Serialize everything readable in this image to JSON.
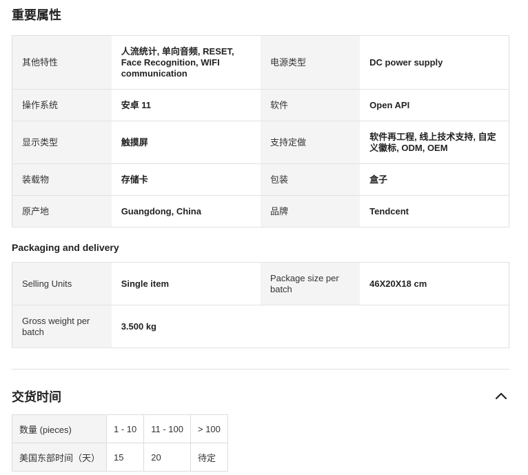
{
  "sections": {
    "key_attributes_title": "重要属性",
    "packaging_title": "Packaging and delivery",
    "lead_time_title": "交货时间"
  },
  "attributes": [
    {
      "k1": "其他特性",
      "v1": "人流统计, 单向音频, RESET, Face Recognition, WIFI communication",
      "k2": "电源类型",
      "v2": "DC power supply"
    },
    {
      "k1": "操作系统",
      "v1": "安卓 11",
      "k2": "软件",
      "v2": "Open API"
    },
    {
      "k1": "显示类型",
      "v1": "触摸屏",
      "k2": "支持定做",
      "v2": "软件再工程, 线上技术支持, 自定义徽标, ODM, OEM"
    },
    {
      "k1": "装载物",
      "v1": "存储卡",
      "k2": "包装",
      "v2": "盒子"
    },
    {
      "k1": "原产地",
      "v1": "Guangdong, China",
      "k2": "品牌",
      "v2": "Tendcent"
    }
  ],
  "packaging": [
    {
      "k1": "Selling Units",
      "v1": "Single item",
      "k2": "Package size per batch",
      "v2": "46X20X18 cm"
    },
    {
      "k1": "Gross weight per batch",
      "v1": "3.500 kg",
      "k2": "",
      "v2": ""
    }
  ],
  "lead_time": {
    "header": [
      "数量 (pieces)",
      "1 - 10",
      "11 - 100",
      "> 100"
    ],
    "row": [
      "美国东部时间（天）",
      "15",
      "20",
      "待定"
    ]
  },
  "icons": {
    "collapse": "chevron-up-icon"
  },
  "colors": {
    "label_bg": "#f4f4f4",
    "border": "#dcdcdc",
    "text": "#222222"
  }
}
